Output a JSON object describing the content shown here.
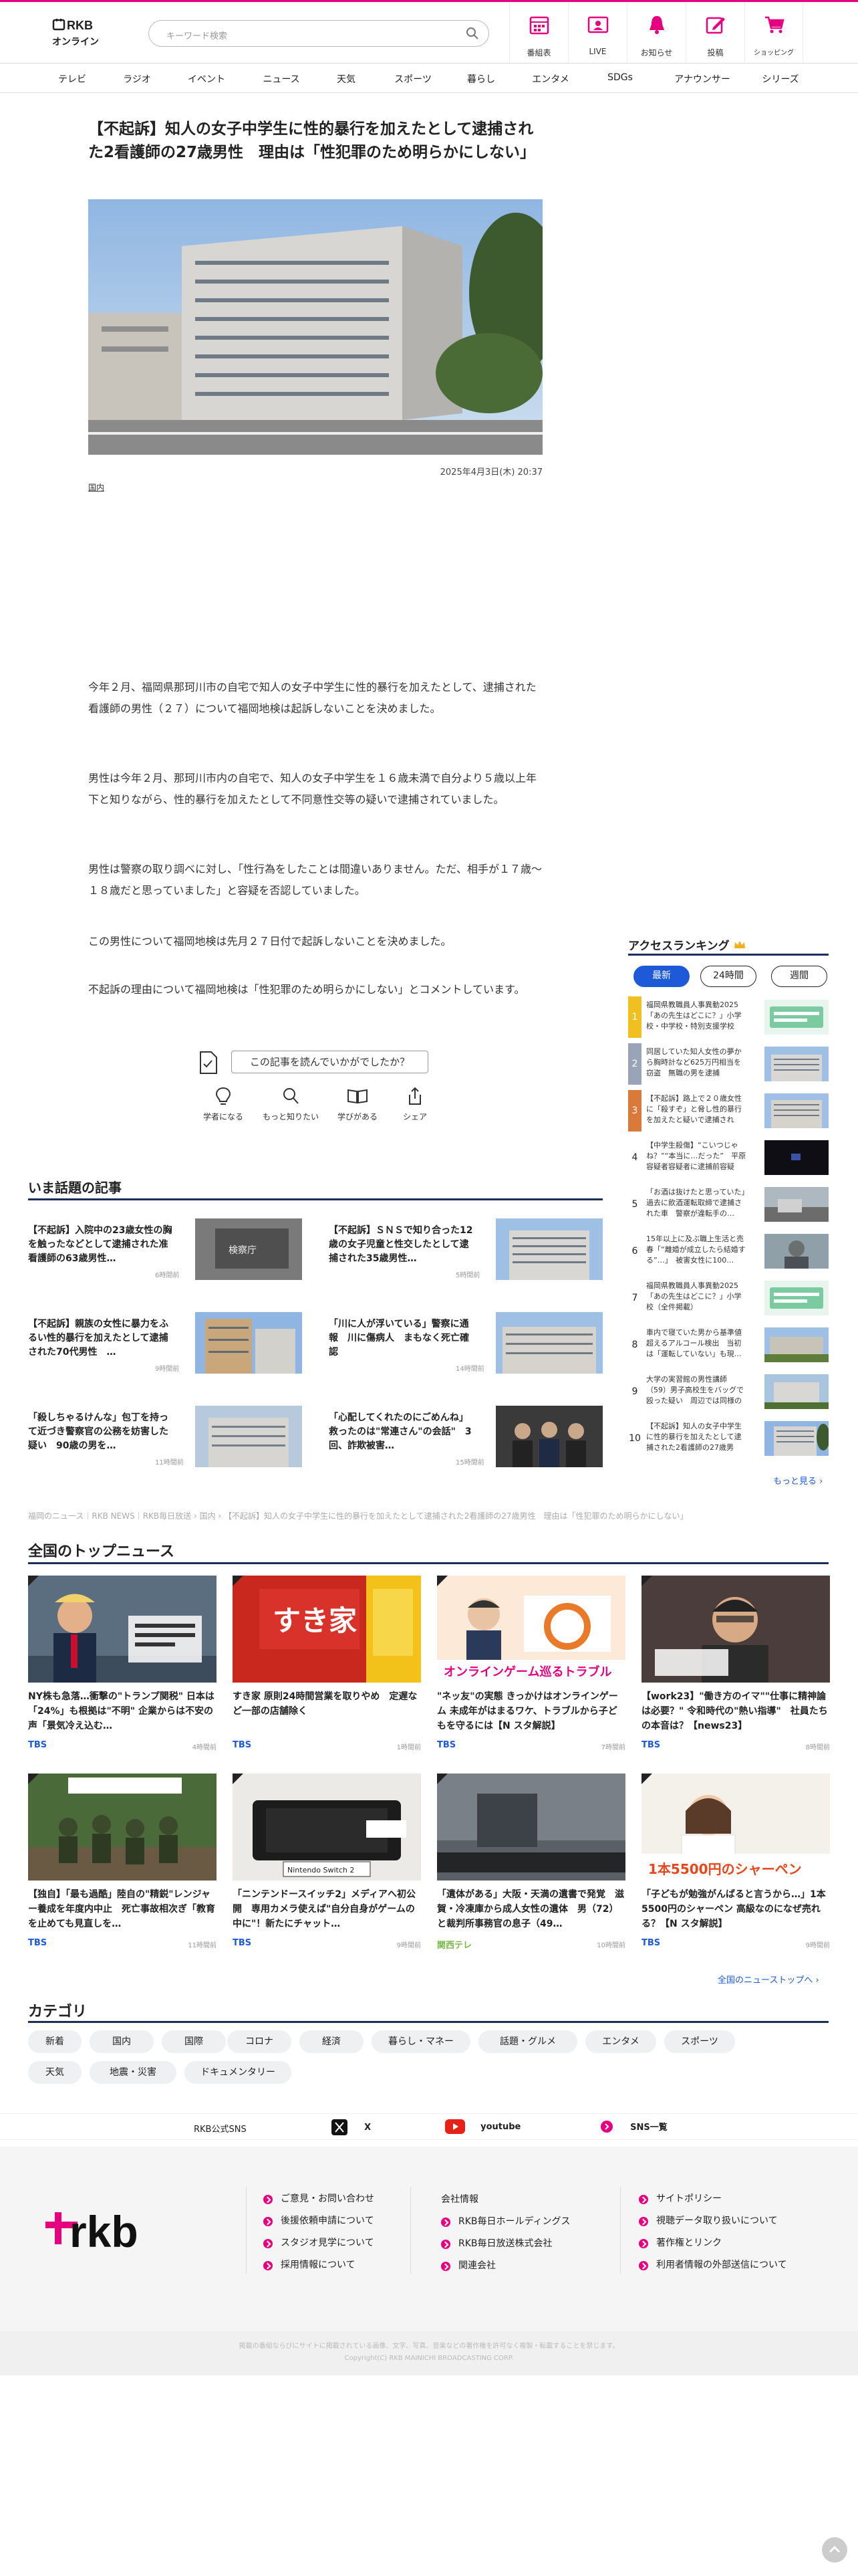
{
  "header": {
    "logo_top": "RKB",
    "logo_bottom": "オンライン",
    "search_placeholder": "キーワード検索",
    "icons": [
      {
        "label": "番組表",
        "icon": "calendar-icon"
      },
      {
        "label": "LIVE",
        "icon": "live-icon"
      },
      {
        "label": "お知らせ",
        "icon": "bell-icon"
      },
      {
        "label": "投稿",
        "icon": "post-icon"
      },
      {
        "label": "ショッピング",
        "icon": "cart-icon"
      }
    ]
  },
  "nav": [
    "テレビ",
    "ラジオ",
    "イベント",
    "ニュース",
    "天気",
    "スポーツ",
    "暮らし",
    "エンタメ",
    "SDGs",
    "アナウンサー",
    "シリーズ"
  ],
  "article": {
    "title": "【不起訴】知人の女子中学生に性的暴行を加えたとして逮捕された2看護師の27歳男性　理由は「性犯罪のため明らかにしない」",
    "date": "2025年4月3日(木) 20:37",
    "category": "国内",
    "paragraphs": [
      "今年２月、福岡県那珂川市の自宅で知人の女子中学生に性的暴行を加えたとして、逮捕された看護師の男性（２７）について福岡地検は起訴しないことを決めました。",
      "男性は今年２月、那珂川市内の自宅で、知人の女子中学生を１６歳未満で自分より５歳以上年下と知りながら、性的暴行を加えたとして不同意性交等の疑いで逮捕されていました。",
      "男性は警察の取り調べに対し、「性行為をしたことは間違いありません。ただ、相手が１７歳～１８歳だと思っていました」と容疑を否認していました。",
      "この男性について福岡地検は先月２７日付で起訴しないことを決めました。",
      "不起訴の理由について福岡地検は「性犯罪のため明らかにしない」とコメントしています。"
    ],
    "survey_label": "この記事を読んでいかがでしたか？",
    "reactions": [
      "学者になる",
      "もっと知りたい",
      "学びがある",
      "シェア"
    ]
  },
  "hot": {
    "heading": "いま話題の記事",
    "items": [
      {
        "title": "【不起訴】入院中の23歳女性の胸を触ったなどとして逮捕された准看護師の63歳男性…",
        "time": "6時間前"
      },
      {
        "title": "【不起訴】ＳＮＳで知り合った12歳の女子児童と性交したとして逮捕された35歳男性…",
        "time": "5時間前"
      },
      {
        "title": "【不起訴】親族の女性に暴力をふるい性的暴行を加えたとして逮捕された70代男性　…",
        "time": "9時間前"
      },
      {
        "title": "「川に人が浮いている」警察に通報　川に傷病人　まもなく死亡確認",
        "time": "14時間前"
      },
      {
        "title": "「殺しちゃるけんな」包丁を持って近づき警察官の公務を妨害した疑い　90歳の男を…",
        "time": "11時間前"
      },
      {
        "title": "「心配してくれたのにごめんね」救ったのは\"常連さん\"の会話\"　3回、詐欺被害…",
        "time": "15時間前"
      }
    ]
  },
  "breadcrumb": "福岡のニュース｜RKB NEWS｜RKB毎日放送 › 国内 › 【不起訴】知人の女子中学生に性的暴行を加えたとして逮捕された2看護師の27歳男性　理由は「性犯罪のため明らかにしない」",
  "ranking": {
    "heading": "アクセスランキング",
    "tabs": [
      "最新",
      "24時間",
      "週間"
    ],
    "items": [
      {
        "rank": "1",
        "title": "福岡県教職員人事異動2025「あの先生はどこに？」小学校・中学校・特別支援学校（…"
      },
      {
        "rank": "2",
        "title": "同居していた知人女性の夢から胸時計など625万円相当を窃盗　無職の男を逮捕"
      },
      {
        "rank": "3",
        "title": "【不起訴】路上で２０歳女性に「殺すぞ」と脅し性的暴行を加えたと疑いで逮捕された…"
      },
      {
        "rank": "4",
        "title": "【中学生殺傷】“こいつじゃね？”“本当に…だった”　平原容疑者容疑者に逮捕前容疑者…"
      },
      {
        "rank": "5",
        "title": "「お酒は抜けたと思っていた」過去に飲酒運転取締で逮捕された車　警察が違転手の…"
      },
      {
        "rank": "6",
        "title": "15年以上に及ぶ職上生活と売春「“離婚が成立したら結婚する”…」　被害女性に100…"
      },
      {
        "rank": "7",
        "title": "福岡県教職員人事異動2025「あの先生はどこに？」小学校（全件掲載）"
      },
      {
        "rank": "8",
        "title": "車内で寝ていた男から基準値超えるアルコール検出　当初は「運転していない」も現…"
      },
      {
        "rank": "9",
        "title": "大学の実習館の男性講師（59）男子高校生をバッグで殴った疑い　周辺では同様の被害…"
      },
      {
        "rank": "10",
        "title": "【不起訴】知人の女子中学生に性的暴行を加えたとして逮捕された2看護師の27歳男性…"
      }
    ],
    "more": "もっと見る ›"
  },
  "top_news": {
    "heading": "全国のトップニュース",
    "items": [
      {
        "title": "NY株も急落…衝撃の\"トランプ関税\" 日本は「24%」も根拠は\"不明\" 企業からは不安の声「景気冷え込む…",
        "source": "TBS",
        "time": "4時間前"
      },
      {
        "title": "すき家 原則24時間営業を取りやめ　定遅など一部の店舗除く",
        "source": "TBS",
        "time": "1時間前"
      },
      {
        "title": "\"ネッ友\"の実態 きっかけはオンラインゲーム 未成年がはまるワケ、トラブルから子どもを守るには【N スタ解説】",
        "source": "TBS",
        "time": "7時間前"
      },
      {
        "title": "【work23】\"働き方のイマ\"\"仕事に精神論は必要？\" 令和時代の\"熱い指導\"　社員たちの本音は？【news23】",
        "source": "TBS",
        "time": "8時間前"
      },
      {
        "title": "【独自】「最も過酷」陸自の\"精鋭\"レンジャー養成を年度内中止　死亡事故相次ぎ「教育を止めても見直しを…",
        "source": "TBS",
        "time": "11時間前"
      },
      {
        "title": "「ニンテンドースイッチ2」メディアへ初公開　専用カメラ使えば\"自分自身がゲームの中に\"！新たにチャット…",
        "source": "TBS",
        "time": "9時間前"
      },
      {
        "title": "「遺体がある」大阪・天満の遺書で発覚　滋賀・冷凍庫から成人女性の遺体　男（72）と裁判所事務官の息子（49…",
        "source": "関西テレ",
        "time": "10時間前"
      },
      {
        "title": "「子どもが勉強がんばると言うから…」1本5500円のシャーペン 高級なのになぜ売れる？【N スタ解説】",
        "source": "TBS",
        "time": "9時間前"
      }
    ],
    "image_captions": [
      "",
      "すき家",
      "オンラインゲーム巡るトラブル",
      "",
      "",
      "Nintendo Switch 2",
      "",
      "1本5500円のシャーペン"
    ],
    "all_link": "全国のニューストップへ ›"
  },
  "categories": {
    "heading": "カテゴリ",
    "items": [
      "新着",
      "国内",
      "国際",
      "コロナ",
      "経済",
      "暮らし・マネー",
      "話題・グルメ",
      "エンタメ",
      "スポーツ",
      "天気",
      "地震・災害",
      "ドキュメンタリー"
    ]
  },
  "sns": {
    "label": "RKB公式SNS",
    "items": [
      "X",
      "youtube",
      "SNS一覧"
    ]
  },
  "footer": {
    "logo": "rkb",
    "col1": [
      "ご意見・お問い合わせ",
      "後援依頼申請について",
      "スタジオ見学について",
      "採用情報について"
    ],
    "col2_heading": "会社情報",
    "col2": [
      "RKB毎日ホールディングス",
      "RKB毎日放送株式会社",
      "関連会社"
    ],
    "col3": [
      "サイトポリシー",
      "視聴データ取り扱いについて",
      "著作権とリンク",
      "利用者情報の外部送信について"
    ],
    "note": "掲載の番組ならびにサイトに掲載されている画像、文字、写真、音楽などの著作権を許可なく複製・転載することを禁じます。",
    "copyright": "Copyright(C) RKB MAINICHI BROADCASTING CORP."
  },
  "colors": {
    "brand": "#e4007f",
    "accent_blue": "#1e5ad7",
    "navy": "#1e2d5a"
  }
}
